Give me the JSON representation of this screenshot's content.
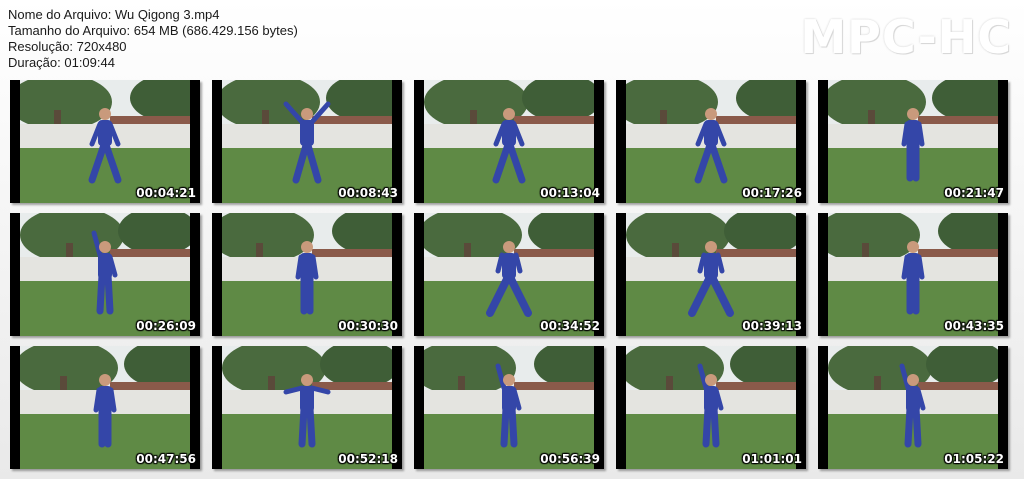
{
  "info": {
    "filename": "Nome do Arquivo: Wu Qigong 3.mp4",
    "filesize": "Tamanho do Arquivo: 654 MB (686.429.156 bytes)",
    "resolution": "Resolução: 720x480",
    "duration": "Duração: 01:09:44"
  },
  "logo": "MPC-HC",
  "colors": {
    "sky": "#e8ecec",
    "foliage": "#4a6a3e",
    "wall": "#e4e4e0",
    "grass": "#5f8a45",
    "suit": "#3446a8"
  },
  "thumbnails": [
    {
      "timestamp": "00:04:21",
      "pose": "stance-arms-down"
    },
    {
      "timestamp": "00:08:43",
      "pose": "arms-raised"
    },
    {
      "timestamp": "00:13:04",
      "pose": "stance-arms-down"
    },
    {
      "timestamp": "00:17:26",
      "pose": "stance-arms-down"
    },
    {
      "timestamp": "00:21:47",
      "pose": "standing"
    },
    {
      "timestamp": "00:26:09",
      "pose": "arm-up"
    },
    {
      "timestamp": "00:30:30",
      "pose": "standing"
    },
    {
      "timestamp": "00:34:52",
      "pose": "horse-stance"
    },
    {
      "timestamp": "00:39:13",
      "pose": "horse-stance"
    },
    {
      "timestamp": "00:43:35",
      "pose": "standing"
    },
    {
      "timestamp": "00:47:56",
      "pose": "standing"
    },
    {
      "timestamp": "00:52:18",
      "pose": "arms-out"
    },
    {
      "timestamp": "00:56:39",
      "pose": "arm-up"
    },
    {
      "timestamp": "01:01:01",
      "pose": "arm-up"
    },
    {
      "timestamp": "01:05:22",
      "pose": "arm-up"
    }
  ]
}
